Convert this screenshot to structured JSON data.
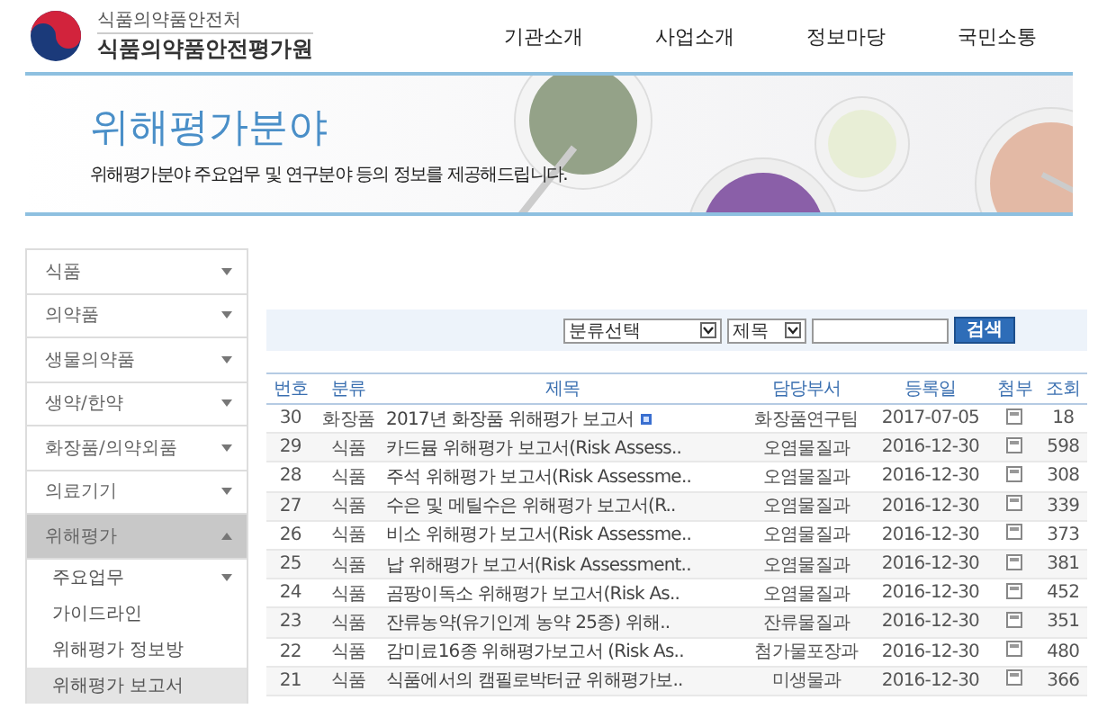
{
  "header": {
    "org_small": "식품의약품안전처",
    "org_name": "식품의약품안전평가원",
    "nav": [
      "기관소개",
      "사업소개",
      "정보마당",
      "국민소통"
    ]
  },
  "banner": {
    "title": "위해평가분야",
    "subtitle": "위해평가분야 주요업무 및 연구분야 등의 정보를 제공해드립니다."
  },
  "sidebar": {
    "items": [
      {
        "label": "식품",
        "kind": "group",
        "expanded": false,
        "selected": false
      },
      {
        "label": "의약품",
        "kind": "group",
        "expanded": false,
        "selected": false
      },
      {
        "label": "생물의약품",
        "kind": "group",
        "expanded": false,
        "selected": false
      },
      {
        "label": "생약/한약",
        "kind": "group",
        "expanded": false,
        "selected": false
      },
      {
        "label": "화장품/의약외품",
        "kind": "group",
        "expanded": false,
        "selected": false
      },
      {
        "label": "의료기기",
        "kind": "group",
        "expanded": false,
        "selected": false
      },
      {
        "label": "위해평가",
        "kind": "group",
        "expanded": true,
        "selected": true,
        "children": [
          {
            "label": "주요업무",
            "kind": "group",
            "expanded": false,
            "selected": false
          },
          {
            "label": "가이드라인",
            "kind": "link",
            "selected": false
          },
          {
            "label": "위해평가 정보방",
            "kind": "link",
            "selected": false
          },
          {
            "label": "위해평가 보고서",
            "kind": "link",
            "selected": true
          }
        ]
      }
    ]
  },
  "search": {
    "category_select": "분류선택",
    "field_select": "제목",
    "button": "검색"
  },
  "table": {
    "columns": [
      "번호",
      "분류",
      "제목",
      "담당부서",
      "등록일",
      "첨부",
      "조회"
    ],
    "rows": [
      {
        "num": "30",
        "category": "화장품",
        "title": "2017년 화장품 위해평가 보고서",
        "new": true,
        "dept": "화장품연구팀",
        "date": "2017-07-05",
        "attachment": true,
        "views": "18"
      },
      {
        "num": "29",
        "category": "식품",
        "title": "카드뮴 위해평가 보고서(Risk Assess..",
        "new": false,
        "dept": "오염물질과",
        "date": "2016-12-30",
        "attachment": true,
        "views": "598"
      },
      {
        "num": "28",
        "category": "식품",
        "title": "주석 위해평가 보고서(Risk Assessme..",
        "new": false,
        "dept": "오염물질과",
        "date": "2016-12-30",
        "attachment": true,
        "views": "308"
      },
      {
        "num": "27",
        "category": "식품",
        "title": "수은 및 메틸수은 위해평가 보고서(R..",
        "new": false,
        "dept": "오염물질과",
        "date": "2016-12-30",
        "attachment": true,
        "views": "339"
      },
      {
        "num": "26",
        "category": "식품",
        "title": "비소 위해평가 보고서(Risk Assessme..",
        "new": false,
        "dept": "오염물질과",
        "date": "2016-12-30",
        "attachment": true,
        "views": "373"
      },
      {
        "num": "25",
        "category": "식품",
        "title": "납 위해평가 보고서(Risk Assessment..",
        "new": false,
        "dept": "오염물질과",
        "date": "2016-12-30",
        "attachment": true,
        "views": "381"
      },
      {
        "num": "24",
        "category": "식품",
        "title": "곰팡이독소 위해평가 보고서(Risk As..",
        "new": false,
        "dept": "오염물질과",
        "date": "2016-12-30",
        "attachment": true,
        "views": "452"
      },
      {
        "num": "23",
        "category": "식품",
        "title": "잔류농약(유기인계 농약 25종) 위해..",
        "new": false,
        "dept": "잔류물질과",
        "date": "2016-12-30",
        "attachment": true,
        "views": "351"
      },
      {
        "num": "22",
        "category": "식품",
        "title": "감미료16종 위해평가보고서 (Risk As..",
        "new": false,
        "dept": "첨가물포장과",
        "date": "2016-12-30",
        "attachment": true,
        "views": "480"
      },
      {
        "num": "21",
        "category": "식품",
        "title": "식품에서의 캠필로박터균 위해평가보..",
        "new": false,
        "dept": "미생물과",
        "date": "2016-12-30",
        "attachment": true,
        "views": "366"
      }
    ]
  }
}
